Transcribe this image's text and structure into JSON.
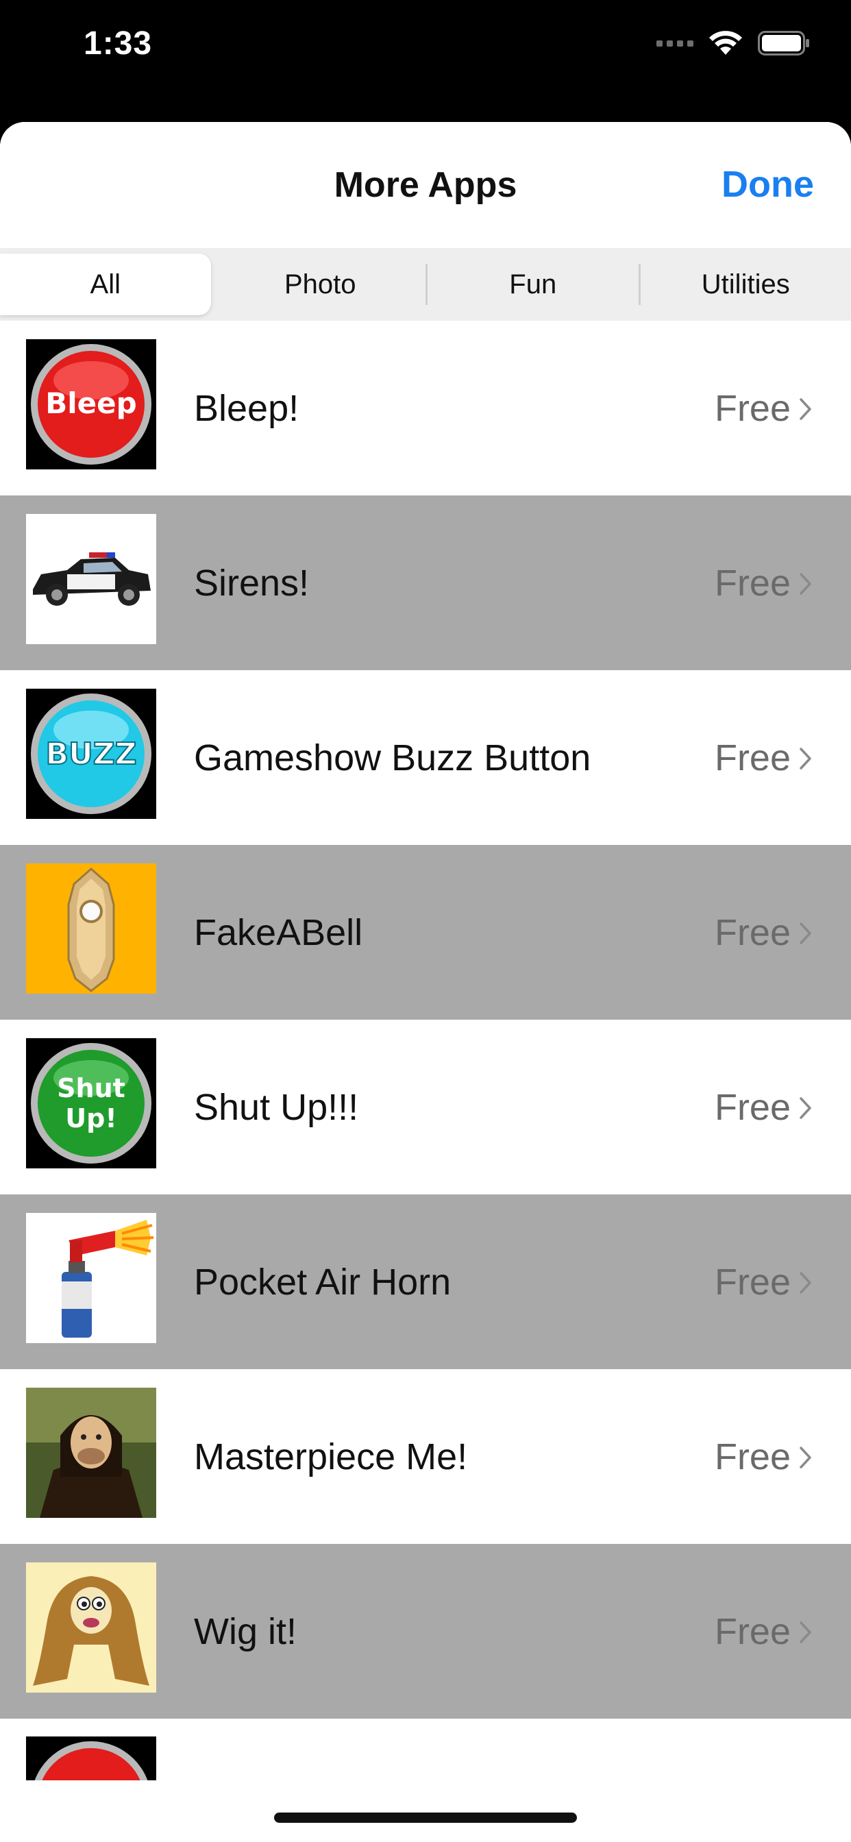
{
  "status": {
    "time": "1:33"
  },
  "header": {
    "title": "More Apps",
    "done_label": "Done"
  },
  "tabs": [
    {
      "label": "All",
      "active": true
    },
    {
      "label": "Photo",
      "active": false
    },
    {
      "label": "Fun",
      "active": false
    },
    {
      "label": "Utilities",
      "active": false
    }
  ],
  "apps": [
    {
      "name": "Bleep!",
      "price": "Free",
      "icon": "bleep-button-icon",
      "icon_text": "Bleep"
    },
    {
      "name": "Sirens!",
      "price": "Free",
      "icon": "police-car-icon"
    },
    {
      "name": "Gameshow Buzz Button",
      "price": "Free",
      "icon": "buzz-button-icon",
      "icon_text": "BUZZ"
    },
    {
      "name": "FakeABell",
      "price": "Free",
      "icon": "doorbell-icon"
    },
    {
      "name": "Shut Up!!!",
      "price": "Free",
      "icon": "shut-up-button-icon",
      "icon_text": "Shut Up!"
    },
    {
      "name": "Pocket Air Horn",
      "price": "Free",
      "icon": "air-horn-icon"
    },
    {
      "name": "Masterpiece Me!",
      "price": "Free",
      "icon": "mona-lisa-icon"
    },
    {
      "name": "Wig it!",
      "price": "Free",
      "icon": "wig-face-icon"
    }
  ],
  "colors": {
    "accent": "#1a7ff0",
    "row_alt": "#a9a9a9"
  }
}
